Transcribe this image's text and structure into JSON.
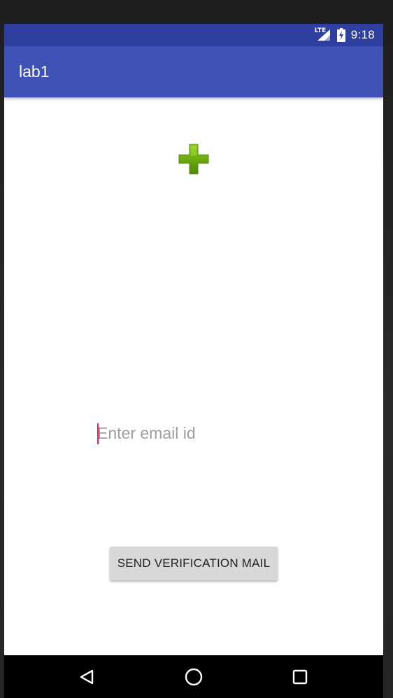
{
  "status_bar": {
    "network_label": "LTE",
    "time": "9:18",
    "icons": [
      "lte-signal-icon",
      "battery-charging-icon"
    ]
  },
  "app_bar": {
    "title": "lab1"
  },
  "logo": {
    "icon": "green-plus-icon",
    "color": "#6aa80e"
  },
  "email_field": {
    "placeholder": "Enter email id",
    "value": ""
  },
  "send_button": {
    "label": "SEND VERIFICATION MAIL"
  },
  "nav_bar": {
    "buttons": [
      "back-icon",
      "home-icon",
      "recents-icon"
    ]
  },
  "colors": {
    "status_bar": "#2f3f9f",
    "app_bar": "#3f51b5",
    "accent_cursor": "#e91e63",
    "button_bg": "#d8d8d8",
    "nav_bar": "#000000"
  }
}
